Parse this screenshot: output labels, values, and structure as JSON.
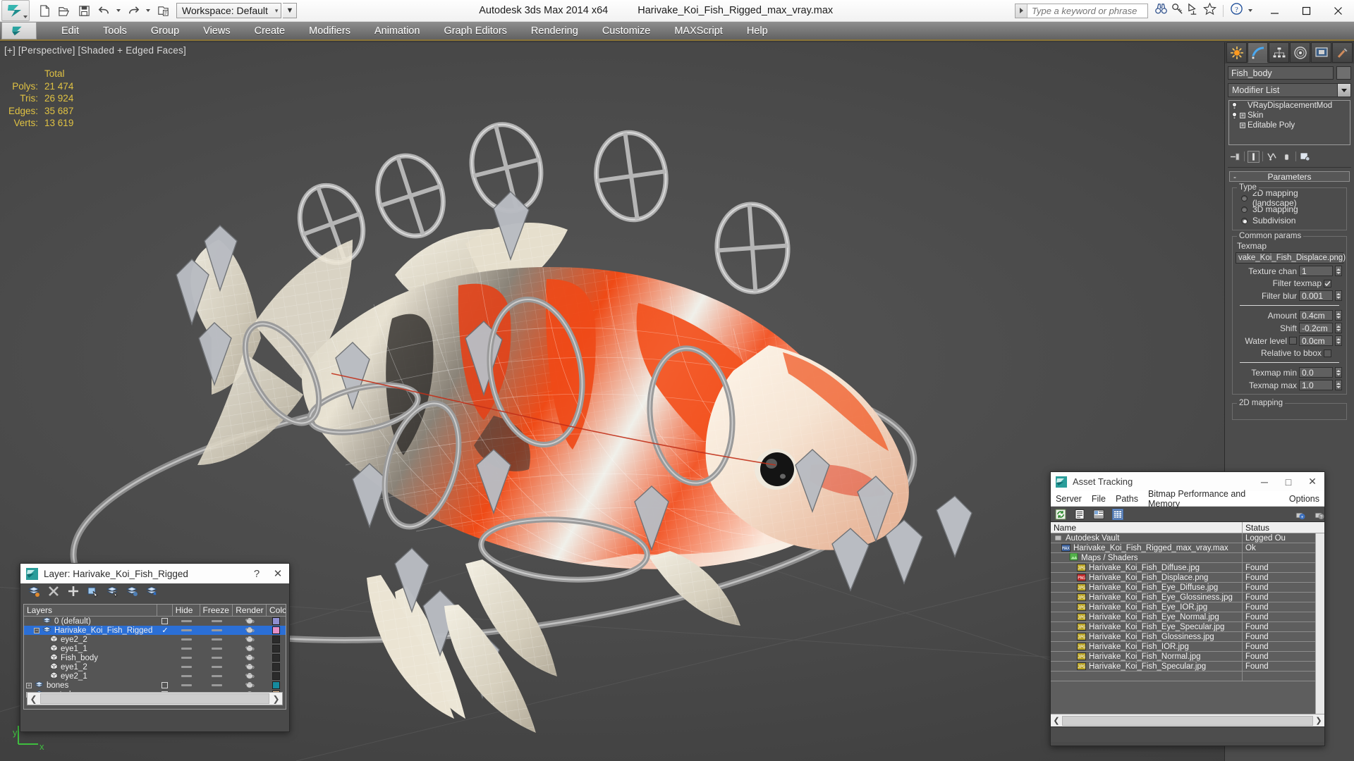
{
  "app": {
    "title": "Autodesk 3ds Max  2014 x64",
    "filename": "Harivake_Koi_Fish_Rigged_max_vray.max",
    "workspace": "Workspace: Default"
  },
  "quick_access": {
    "new": "new-file",
    "open": "open-file",
    "save": "save-file",
    "undo": "undo",
    "redo": "redo",
    "project": "set-project-folder"
  },
  "search": {
    "placeholder": "Type a keyword or phrase"
  },
  "window_controls": {
    "minimize": "─",
    "maximize": "□",
    "close": "✕"
  },
  "menu": {
    "items": [
      "Edit",
      "Tools",
      "Group",
      "Views",
      "Create",
      "Modifiers",
      "Animation",
      "Graph Editors",
      "Rendering",
      "Customize",
      "MAXScript",
      "Help"
    ]
  },
  "viewport": {
    "label": "[+] [Perspective] [Shaded + Edged Faces]",
    "stats": {
      "header": "Total",
      "rows": [
        {
          "label": "Polys:",
          "value": "21 474"
        },
        {
          "label": "Tris:",
          "value": "26 924"
        },
        {
          "label": "Edges:",
          "value": "35 687"
        },
        {
          "label": "Verts:",
          "value": "13 619"
        }
      ]
    },
    "axis": {
      "y": "y",
      "x": "x"
    },
    "stats_color": "#e0c243"
  },
  "command_panel": {
    "tabs": [
      "create-tab",
      "modify-tab",
      "hierarchy-tab",
      "motion-tab",
      "display-tab",
      "utilities-tab"
    ],
    "active_tab_index": 1,
    "object_name": "Fish_body",
    "modifier_list_label": "Modifier List",
    "stack": [
      {
        "label": "VRayDisplacementMod",
        "has_bulb": true,
        "expandable": false
      },
      {
        "label": "Skin",
        "has_bulb": true,
        "expandable": true
      },
      {
        "label": "Editable Poly",
        "has_bulb": false,
        "expandable": true
      }
    ],
    "rollout_parameters": "Parameters",
    "rollout_2d_mapping": "2D mapping",
    "type_group": {
      "title": "Type",
      "options": [
        "2D mapping (landscape)",
        "3D mapping",
        "Subdivision"
      ],
      "selected_index": 2
    },
    "common_params": {
      "title": "Common params",
      "texmap_label": "Texmap",
      "texmap_value": "vake_Koi_Fish_Displace.png)",
      "texture_chan_label": "Texture chan",
      "texture_chan_value": "1",
      "filter_texmap_label": "Filter texmap",
      "filter_texmap_checked": true,
      "filter_blur_label": "Filter blur",
      "filter_blur_value": "0.001",
      "amount_label": "Amount",
      "amount_value": "0.4cm",
      "shift_label": "Shift",
      "shift_value": "-0.2cm",
      "water_level_label": "Water level",
      "water_level_checked": false,
      "water_level_value": "0.0cm",
      "relative_to_bbox_label": "Relative to bbox",
      "relative_to_bbox_checked": false,
      "texmap_min_label": "Texmap min",
      "texmap_min_value": "0.0",
      "texmap_max_label": "Texmap max",
      "texmap_max_value": "1.0"
    }
  },
  "layer_dialog": {
    "title": "Layer: Harivake_Koi_Fish_Rigged",
    "help_glyph": "?",
    "close_glyph": "✕",
    "toolbar": [
      "create-new-layer",
      "delete-layer",
      "add-selection-to-layer",
      "select-objects-in-layer",
      "select-highlighted-layers-objects",
      "highlight-selected-objects-layer",
      "hide-unhide-layer"
    ],
    "columns": [
      "Layers",
      "",
      "Hide",
      "Freeze",
      "Render",
      "Color"
    ],
    "rows": [
      {
        "name": "0 (default)",
        "indent": 1,
        "icon": "layer-icon",
        "expand": false,
        "selected": false,
        "checkbox": "empty",
        "hide": "dash",
        "freeze": "dash",
        "render": "teapot",
        "color": "#8f8fd0"
      },
      {
        "name": "Harivake_Koi_Fish_Rigged",
        "indent": 1,
        "icon": "layer-icon",
        "expand": true,
        "selected": true,
        "checkbox": "check",
        "hide": "dash",
        "freeze": "dash",
        "render": "teapot",
        "color": "#e48fc8"
      },
      {
        "name": "eye2_2",
        "indent": 2,
        "icon": "object-icon",
        "expand": false,
        "selected": false,
        "checkbox": "none",
        "hide": "dash",
        "freeze": "dash",
        "render": "teapot",
        "color": "#2b2b2b"
      },
      {
        "name": "eye1_1",
        "indent": 2,
        "icon": "object-icon",
        "expand": false,
        "selected": false,
        "checkbox": "none",
        "hide": "dash",
        "freeze": "dash",
        "render": "teapot",
        "color": "#2b2b2b"
      },
      {
        "name": "Fish_body",
        "indent": 2,
        "icon": "object-icon",
        "expand": false,
        "selected": false,
        "checkbox": "none",
        "hide": "dash",
        "freeze": "dash",
        "render": "teapot",
        "color": "#2b2b2b"
      },
      {
        "name": "eye1_2",
        "indent": 2,
        "icon": "object-icon",
        "expand": false,
        "selected": false,
        "checkbox": "none",
        "hide": "dash",
        "freeze": "dash",
        "render": "teapot",
        "color": "#2b2b2b"
      },
      {
        "name": "eye2_1",
        "indent": 2,
        "icon": "object-icon",
        "expand": false,
        "selected": false,
        "checkbox": "none",
        "hide": "dash",
        "freeze": "dash",
        "render": "teapot",
        "color": "#2b2b2b"
      },
      {
        "name": "bones",
        "indent": 0,
        "icon": "layer-icon",
        "expand": true,
        "selected": false,
        "checkbox": "empty",
        "hide": "dash",
        "freeze": "dash",
        "render": "teapot",
        "color": "#168a9e"
      },
      {
        "name": "controls",
        "indent": 0,
        "icon": "layer-icon",
        "expand": true,
        "selected": false,
        "checkbox": "empty",
        "hide": "dash",
        "freeze": "dash",
        "render": "teapot",
        "color": "#f0c49a"
      }
    ]
  },
  "asset_tracking": {
    "title": "Asset Tracking",
    "menu": [
      "Server",
      "File",
      "Paths",
      "Bitmap Performance and Memory",
      "Options"
    ],
    "toolbar": [
      "refresh-icon",
      "list-view-icon",
      "details-view-icon",
      "grid-view-icon",
      "vault-login-icon",
      "vault-logout-icon"
    ],
    "active_toolbar_index": 3,
    "columns": [
      "Name",
      "Status"
    ],
    "rows": [
      {
        "name": "Autodesk Vault",
        "status": "Logged Ou",
        "indent": 0,
        "icon": "vault",
        "tag": ""
      },
      {
        "name": "Harivake_Koi_Fish_Rigged_max_vray.max",
        "status": "Ok",
        "indent": 1,
        "icon": "max",
        "tag": "MAX"
      },
      {
        "name": "Maps / Shaders",
        "status": "",
        "indent": 2,
        "icon": "maps",
        "tag": ""
      },
      {
        "name": "Harivake_Koi_Fish_Diffuse.jpg",
        "status": "Found",
        "indent": 3,
        "icon": "jpg",
        "tag": "JPG"
      },
      {
        "name": "Harivake_Koi_Fish_Displace.png",
        "status": "Found",
        "indent": 3,
        "icon": "png",
        "tag": "PNG"
      },
      {
        "name": "Harivake_Koi_Fish_Eye_Diffuse.jpg",
        "status": "Found",
        "indent": 3,
        "icon": "jpg",
        "tag": "JPG"
      },
      {
        "name": "Harivake_Koi_Fish_Eye_Glossiness.jpg",
        "status": "Found",
        "indent": 3,
        "icon": "jpg",
        "tag": "JPG"
      },
      {
        "name": "Harivake_Koi_Fish_Eye_IOR.jpg",
        "status": "Found",
        "indent": 3,
        "icon": "jpg",
        "tag": "JPG"
      },
      {
        "name": "Harivake_Koi_Fish_Eye_Normal.jpg",
        "status": "Found",
        "indent": 3,
        "icon": "jpg",
        "tag": "JPG"
      },
      {
        "name": "Harivake_Koi_Fish_Eye_Specular.jpg",
        "status": "Found",
        "indent": 3,
        "icon": "jpg",
        "tag": "JPG"
      },
      {
        "name": "Harivake_Koi_Fish_Glossiness.jpg",
        "status": "Found",
        "indent": 3,
        "icon": "jpg",
        "tag": "JPG"
      },
      {
        "name": "Harivake_Koi_Fish_IOR.jpg",
        "status": "Found",
        "indent": 3,
        "icon": "jpg",
        "tag": "JPG"
      },
      {
        "name": "Harivake_Koi_Fish_Normal.jpg",
        "status": "Found",
        "indent": 3,
        "icon": "jpg",
        "tag": "JPG"
      },
      {
        "name": "Harivake_Koi_Fish_Specular.jpg",
        "status": "Found",
        "indent": 3,
        "icon": "jpg",
        "tag": "JPG"
      },
      {
        "name": "",
        "status": "",
        "indent": 0,
        "icon": "",
        "tag": ""
      }
    ]
  },
  "colors": {
    "accent_gold": "#8a7437",
    "stats_yellow": "#e0c243",
    "selection_blue": "#2b6fd6",
    "viewport_bg": "#454545"
  }
}
